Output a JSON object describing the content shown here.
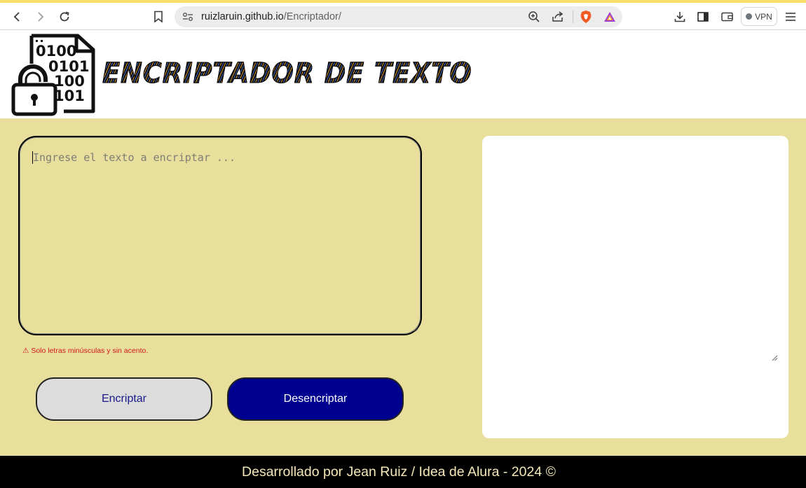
{
  "browser": {
    "url_host": "ruizlaruin.github.io",
    "url_path": "/Encriptador/",
    "vpn_label": "VPN",
    "icons": [
      "back-icon",
      "forward-icon",
      "reload-icon",
      "bookmark-icon",
      "site-settings-icon",
      "zoom-icon",
      "share-icon",
      "brave-shields-icon",
      "brave-rewards-icon",
      "download-icon",
      "sidebar-icon",
      "wallet-icon",
      "menu-icon"
    ]
  },
  "header": {
    "title": "ENCRIPTADOR DE TEXTO",
    "logo_digits": [
      "0100",
      "0101",
      "100",
      "101"
    ]
  },
  "input": {
    "placeholder": "Ingrese el texto a encriptar ...",
    "warning": "⚠ Solo letras minúsculas y sin acento."
  },
  "buttons": {
    "encrypt": "Encriptar",
    "decrypt": "Desencriptar"
  },
  "output": {
    "text": ""
  },
  "footer": {
    "text": "Desarrollado por Jean Ruiz / Idea de Alura - 2024 ©"
  },
  "colors": {
    "page_bg": "#e8df9c",
    "decrypt_button": "#000090",
    "encrypt_button": "#dcdcdc",
    "warning": "#d01818",
    "footer_bg": "#000000",
    "footer_text": "#f4e7b8"
  }
}
